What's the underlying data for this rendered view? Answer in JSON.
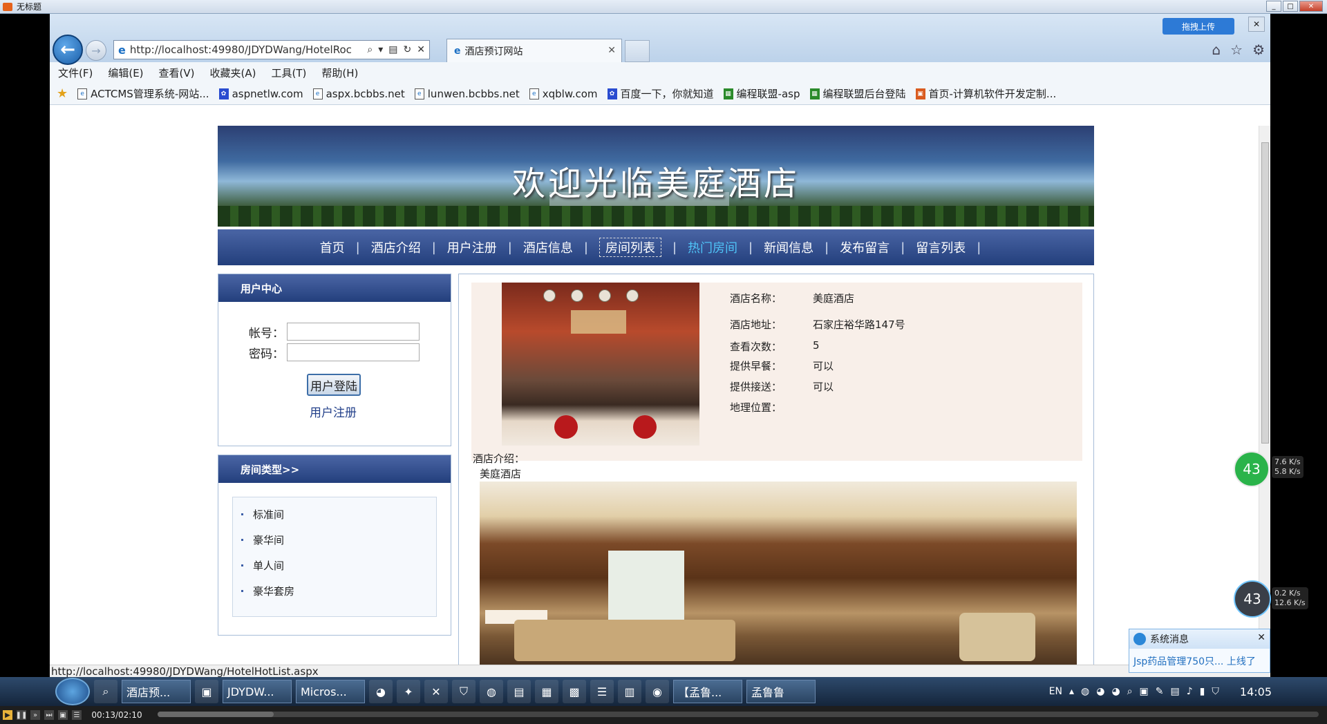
{
  "window": {
    "title": "无标题"
  },
  "browser": {
    "url": "http://localhost:49980/JDYDWang/HotelRoc",
    "tab_title": "酒店预订网站",
    "baidu_upload": "拖拽上传",
    "menu": [
      "文件(F)",
      "编辑(E)",
      "查看(V)",
      "收藏夹(A)",
      "工具(T)",
      "帮助(H)"
    ],
    "favorites": [
      {
        "label": "ACTCMS管理系统-网站...",
        "icon": "page-icon"
      },
      {
        "label": "aspnetlw.com",
        "icon": "paw-icon"
      },
      {
        "label": "aspx.bcbbs.net",
        "icon": "page-icon"
      },
      {
        "label": "lunwen.bcbbs.net",
        "icon": "page-icon"
      },
      {
        "label": "xqblw.com",
        "icon": "page-icon"
      },
      {
        "label": "百度一下，你就知道",
        "icon": "paw-icon"
      },
      {
        "label": "编程联盟-asp",
        "icon": "grid-icon"
      },
      {
        "label": "编程联盟后台登陆",
        "icon": "grid-icon"
      },
      {
        "label": "首页-计算机软件开发定制...",
        "icon": "red-icon"
      }
    ],
    "status_url": "http://localhost:49980/JDYDWang/HotelHotList.aspx"
  },
  "site": {
    "banner_title": "欢迎光临美庭酒店",
    "nav": [
      {
        "label": "首页",
        "state": "normal"
      },
      {
        "label": "酒店介绍",
        "state": "normal"
      },
      {
        "label": "用户注册",
        "state": "normal"
      },
      {
        "label": "酒店信息",
        "state": "normal"
      },
      {
        "label": "房间列表",
        "state": "focused"
      },
      {
        "label": "热门房间",
        "state": "active"
      },
      {
        "label": "新闻信息",
        "state": "normal"
      },
      {
        "label": "发布留言",
        "state": "normal"
      },
      {
        "label": "留言列表",
        "state": "normal"
      }
    ],
    "nav_separator": "|",
    "user_center": {
      "title": "用户中心",
      "account_label": "帐号：",
      "password_label": "密码：",
      "account_value": "",
      "password_value": "",
      "login_button": "用户登陆",
      "register_link": "用户注册"
    },
    "room_types": {
      "title": "房间类型>>",
      "items": [
        "标准间",
        "豪华间",
        "单人间",
        "豪华套房"
      ]
    },
    "hotel": {
      "fields": [
        {
          "label": "酒店名称：",
          "value": "美庭酒店"
        },
        {
          "label": "酒店地址：",
          "value": "石家庄裕华路147号"
        },
        {
          "label": "查看次数：",
          "value": "5"
        },
        {
          "label": "提供早餐：",
          "value": "可以"
        },
        {
          "label": "提供接送：",
          "value": "可以"
        },
        {
          "label": "地理位置：",
          "value": ""
        }
      ],
      "intro_label": "酒店介绍：",
      "intro_text": "美庭酒店"
    }
  },
  "overlays": {
    "net_green": {
      "percent": "43",
      "up": "7.6 K/s",
      "down": "5.8 K/s"
    },
    "net_dark": {
      "percent": "43",
      "up": "0.2 K/s",
      "down": "12.6 K/s"
    },
    "sys_msg": {
      "title": "系统消息",
      "body": "Jsp药品管理750只... 上线了"
    }
  },
  "taskbar": {
    "items": [
      "酒店预...",
      "JDYDW...",
      "Micros...",
      "【孟鲁...",
      "孟鲁鲁"
    ],
    "lang": "EN",
    "clock": "14:05"
  },
  "player": {
    "time": "00:13/02:10",
    "progress": 0.1
  },
  "colors": {
    "nav_bg": "#233f7c",
    "nav_active": "#4fc3f7",
    "accent": "#2b87d8"
  }
}
